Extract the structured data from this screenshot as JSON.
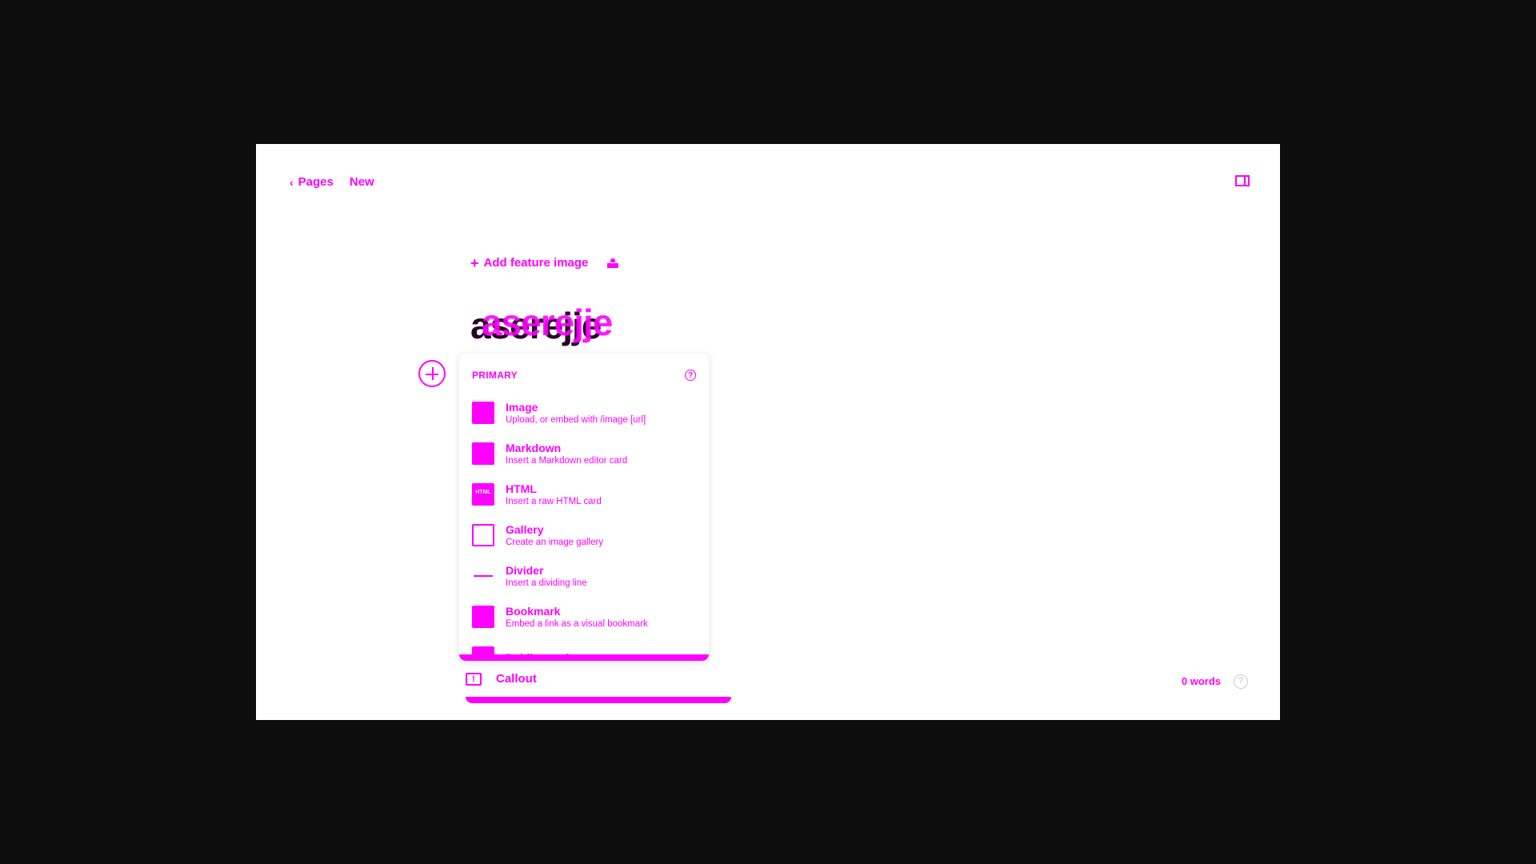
{
  "nav": {
    "back_label": "Pages",
    "status": "New"
  },
  "editor": {
    "add_feature_image": "Add feature image",
    "title": "aserejje"
  },
  "card_menu": {
    "section": "PRIMARY",
    "help": "?",
    "items": [
      {
        "name": "Image",
        "desc": "Upload, or embed with /image [url]",
        "icon": "image-icon"
      },
      {
        "name": "Markdown",
        "desc": "Insert a Markdown editor card",
        "icon": "markdown-icon"
      },
      {
        "name": "HTML",
        "desc": "Insert a raw HTML card",
        "icon": "html-icon"
      },
      {
        "name": "Gallery",
        "desc": "Create an image gallery",
        "icon": "gallery-icon"
      },
      {
        "name": "Divider",
        "desc": "Insert a dividing line",
        "icon": "divider-icon"
      },
      {
        "name": "Bookmark",
        "desc": "Embed a link as a visual bookmark",
        "icon": "bookmark-icon"
      },
      {
        "name": "Public preview",
        "desc": "",
        "icon": "preview-icon"
      }
    ]
  },
  "callout_label": "Callout",
  "footer": {
    "word_count": "0 words",
    "help": "?"
  },
  "colors": {
    "accent": "#ff00ff",
    "background": "#0d0d0d",
    "canvas": "#ffffff"
  }
}
